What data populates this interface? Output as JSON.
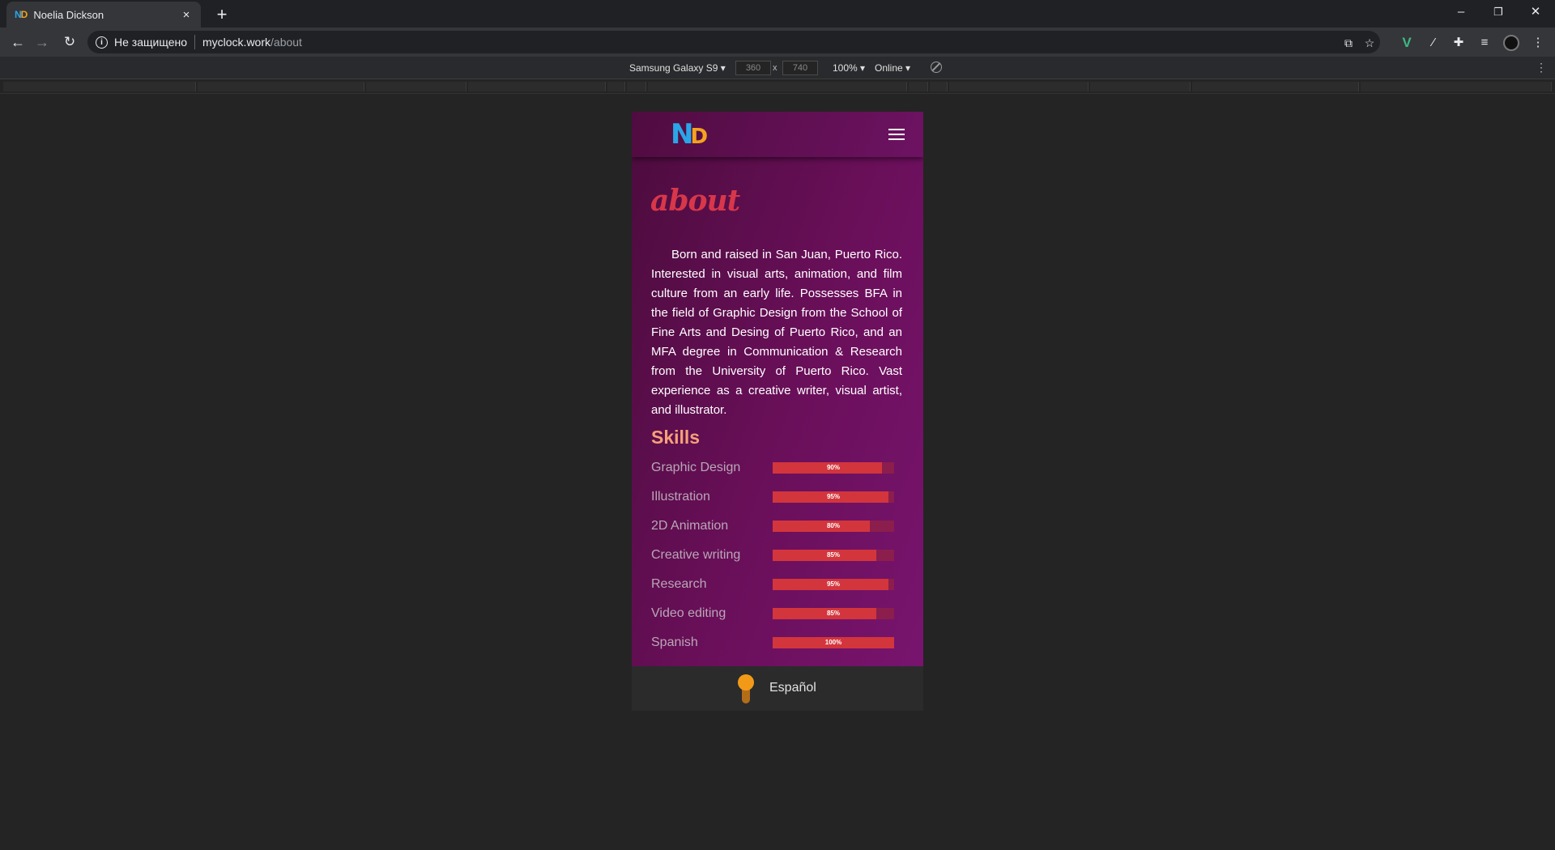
{
  "browser": {
    "tab_title": "Noelia Dickson",
    "favicon_n": "N",
    "favicon_d": "D",
    "tab_close": "×",
    "new_tab": "+",
    "security_label": "Не защищено",
    "url_host": "myclock.work",
    "url_path": "/about",
    "window_controls": [
      "–",
      "❐",
      "✕"
    ]
  },
  "devtools": {
    "device_name": "Samsung Galaxy S9 ▾",
    "width": "360",
    "height": "740",
    "times": "x",
    "zoom": "100% ▾",
    "network": "Online ▾"
  },
  "site": {
    "logo_n": "N",
    "logo_d": "D",
    "page_title": "about",
    "bio": "Born and raised in San Juan, Puerto Rico. Interested in visual arts, animation, and film culture from an early life. Possesses BFA in the field of Graphic Design from the School of Fine Arts and Desing of Puerto Rico, and an MFA degree in Communication & Research from the University of Puerto Rico. Vast experience as a creative writer, visual artist, and illustrator.",
    "skills_title": "Skills",
    "skills": [
      {
        "label": "Graphic Design",
        "value": 90,
        "text": "90%"
      },
      {
        "label": "Illustration",
        "value": 95,
        "text": "95%"
      },
      {
        "label": "2D Animation",
        "value": 80,
        "text": "80%"
      },
      {
        "label": "Creative writing",
        "value": 85,
        "text": "85%"
      },
      {
        "label": "Research",
        "value": 95,
        "text": "95%"
      },
      {
        "label": "Video editing",
        "value": 85,
        "text": "85%"
      },
      {
        "label": "Spanish",
        "value": 100,
        "text": "100%"
      }
    ],
    "language_toggle_label": "Español"
  },
  "colors": {
    "accent_red": "#d3353c",
    "title_red": "#d8374a",
    "skills_heading": "#f5a07a",
    "toggle_orange": "#f29a18",
    "logo_blue": "#2aa6e8",
    "logo_orange": "#f3a31e"
  }
}
